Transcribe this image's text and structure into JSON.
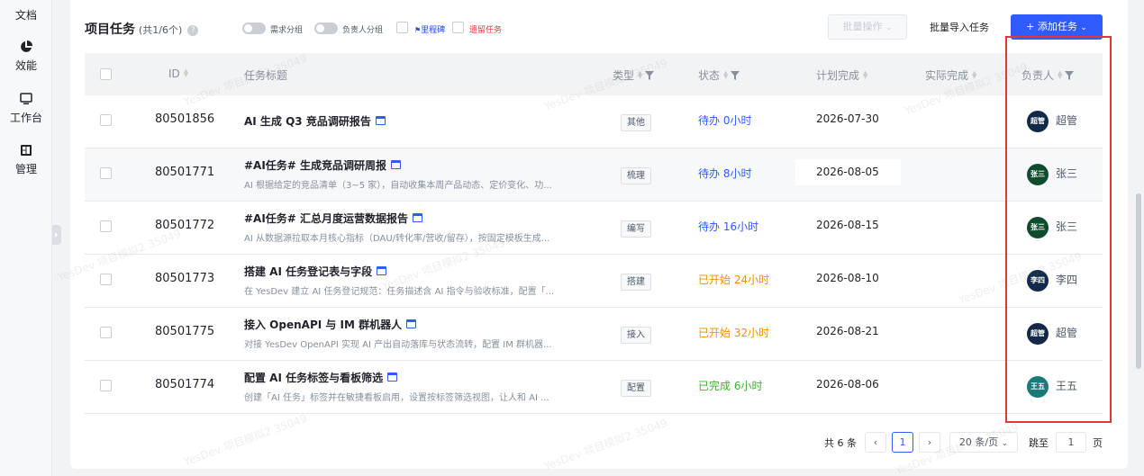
{
  "nav": {
    "items": [
      {
        "label": "文档"
      },
      {
        "label": "效能"
      },
      {
        "label": "工作台"
      },
      {
        "label": "管理"
      }
    ]
  },
  "toolbar": {
    "title": "项目任务",
    "count": "(共1/6个)",
    "help": "?",
    "group_by_requirement": "需求分组",
    "group_by_owner": "负责人分组",
    "milestone": "里程碑",
    "legacy_tasks": "遗留任务",
    "batch_ops": "批量操作",
    "bulk_import": "批量导入任务",
    "add_task": "+ 添加任务"
  },
  "table": {
    "columns": {
      "id": "ID",
      "title": "任务标题",
      "type": "类型",
      "status": "状态",
      "planned": "计划完成",
      "actual": "实际完成",
      "owner": "负责人"
    },
    "rows": [
      {
        "id": "80501856",
        "title": "AI 生成 Q3 竞品调研报告",
        "desc": "",
        "type": "其他",
        "status": "待办 0小时",
        "status_kind": "todo",
        "planned": "2026-07-30",
        "actual": "",
        "owner": "超管",
        "avatar_text": "超管",
        "avatar_color": "#12294a"
      },
      {
        "id": "80501771",
        "title": "#AI任务# 生成竞品调研周报",
        "desc": "AI 根据给定的竞品清单（3~5 家），自动收集本周产品动态、定价变化、功...",
        "type": "梳理",
        "status": "待办 8小时",
        "status_kind": "todo",
        "planned": "2026-08-05",
        "actual": "",
        "owner": "张三",
        "avatar_text": "张三",
        "avatar_color": "#0f4c2e"
      },
      {
        "id": "80501772",
        "title": "#AI任务# 汇总月度运营数据报告",
        "desc": "AI 从数据源拉取本月核心指标（DAU/转化率/营收/留存），按固定模板生成...",
        "type": "编写",
        "status": "待办 16小时",
        "status_kind": "todo",
        "planned": "2026-08-15",
        "actual": "",
        "owner": "张三",
        "avatar_text": "张三",
        "avatar_color": "#0f4c2e"
      },
      {
        "id": "80501773",
        "title": "搭建 AI 任务登记表与字段",
        "desc": "在 YesDev 建立 AI 任务登记规范：任务描述含 AI 指令与验收标准，配置「...",
        "type": "搭建",
        "status": "已开始 24小时",
        "status_kind": "start",
        "planned": "2026-08-10",
        "actual": "",
        "owner": "李四",
        "avatar_text": "李四",
        "avatar_color": "#12294a"
      },
      {
        "id": "80501775",
        "title": "接入 OpenAPI 与 IM 群机器人",
        "desc": "对接 YesDev OpenAPI 实现 AI 产出自动落库与状态流转，配置 IM 群机器...",
        "type": "接入",
        "status": "已开始 32小时",
        "status_kind": "start",
        "planned": "2026-08-21",
        "actual": "",
        "owner": "超管",
        "avatar_text": "超管",
        "avatar_color": "#12294a"
      },
      {
        "id": "80501774",
        "title": "配置 AI 任务标签与看板筛选",
        "desc": "创建「AI 任务」标签并在敏捷看板启用，设置按标签筛选视图，让人和 AI ...",
        "type": "配置",
        "status": "已完成 6小时",
        "status_kind": "done",
        "planned": "2026-08-06",
        "actual": "",
        "owner": "王五",
        "avatar_text": "王五",
        "avatar_color": "#1a7a7a"
      }
    ]
  },
  "pagination": {
    "total": "共 6 条",
    "prev": "‹",
    "current": "1",
    "next": "›",
    "page_size": "20 条/页",
    "jump_label": "跳至",
    "jump_value": "1",
    "page_unit": "页"
  },
  "watermark": "YesDev 项目模拟2 35049",
  "colors": {
    "primary": "#2f5bff",
    "todo": "#2f5bff",
    "started": "#f29100",
    "done": "#3cb034",
    "highlight_frame": "#e5343a"
  }
}
